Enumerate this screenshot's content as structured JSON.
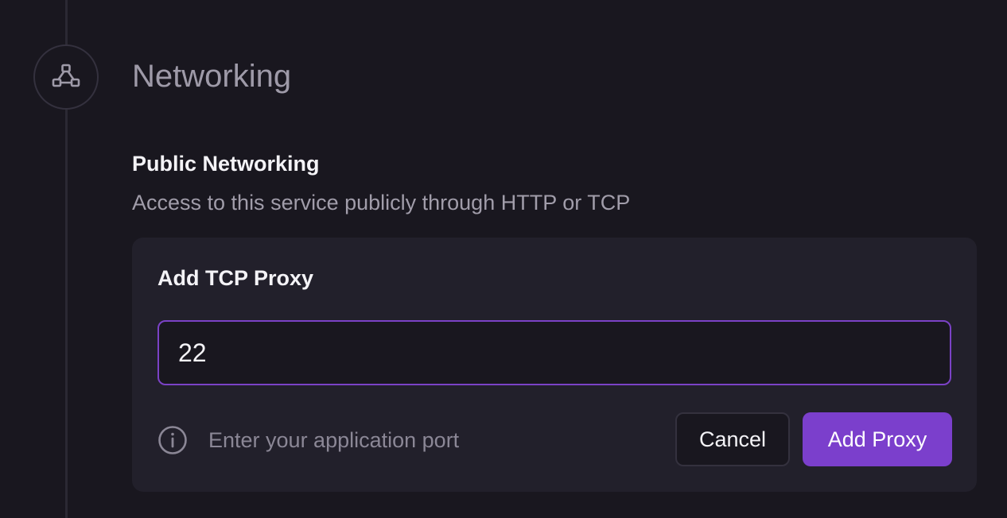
{
  "section": {
    "title": "Networking",
    "icon": "network-icon"
  },
  "public_networking": {
    "title": "Public Networking",
    "description": "Access to this service publicly through HTTP or TCP"
  },
  "tcp_proxy_form": {
    "title": "Add TCP Proxy",
    "port_value": "22",
    "hint": "Enter your application port",
    "hint_icon": "info-icon",
    "cancel_label": "Cancel",
    "submit_label": "Add Proxy"
  },
  "colors": {
    "background": "#19171f",
    "card": "#22202b",
    "accent": "#7b3fcc",
    "input_focus_border": "#7b42c6"
  }
}
